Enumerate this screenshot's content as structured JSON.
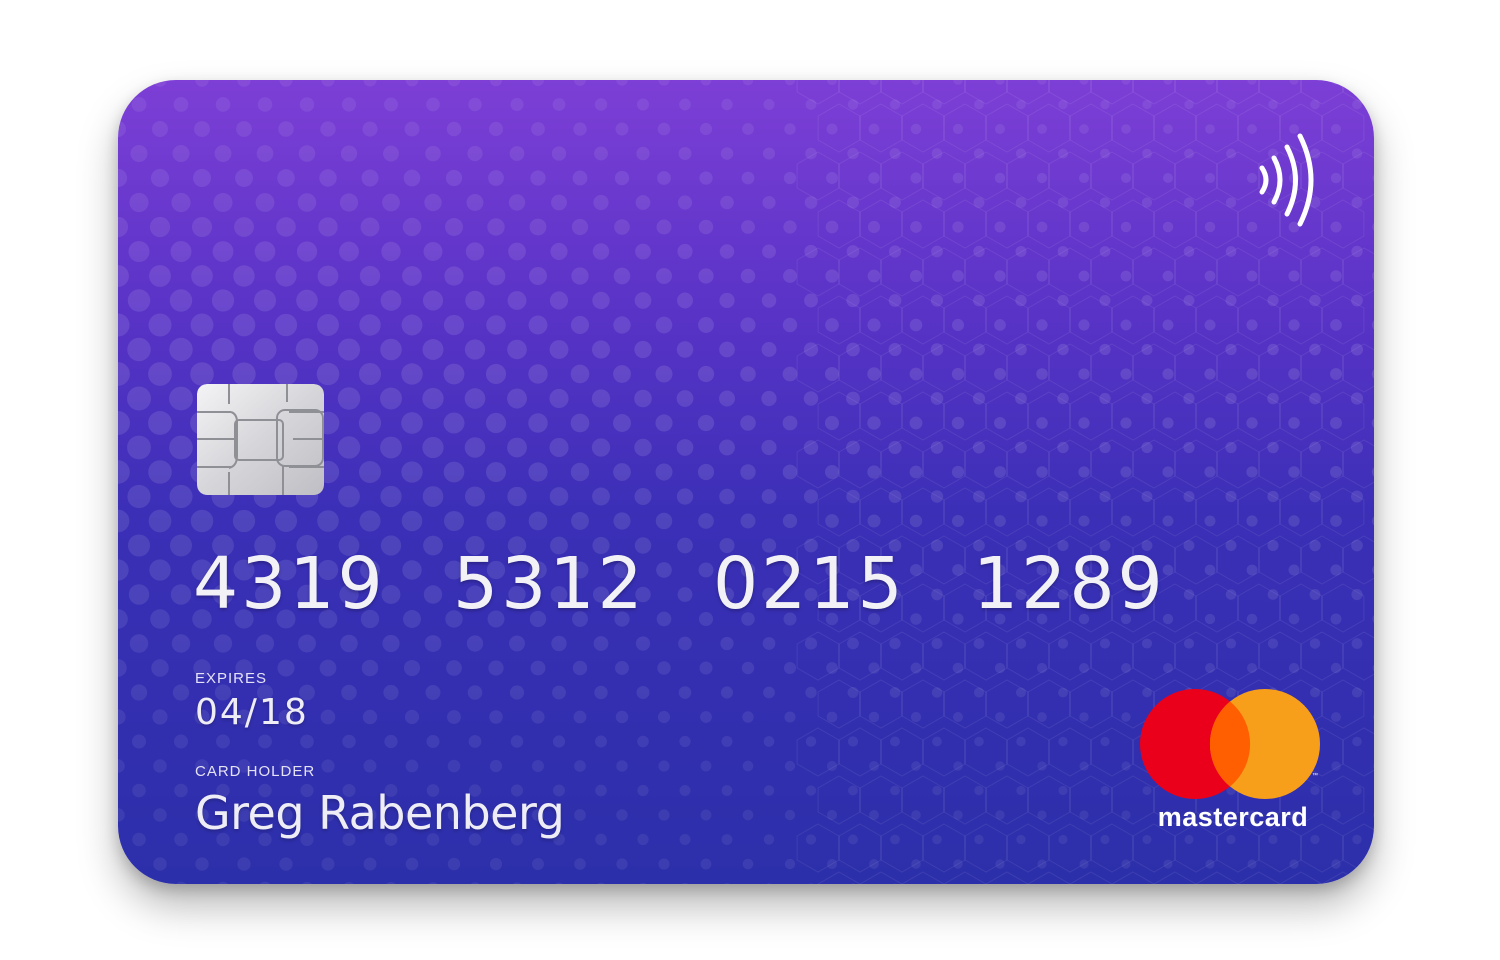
{
  "card": {
    "number_groups": [
      "4319",
      "5312",
      "0215",
      "1289"
    ],
    "expires_label": "EXPIRES",
    "expires_value": "04/18",
    "holder_label": "CARD HOLDER",
    "holder_name": "Greg Rabenberg",
    "brand": "mastercard",
    "colors": {
      "gradient_top": "#7d3fd6",
      "gradient_bottom": "#2c2faa",
      "mc_red": "#eb001b",
      "mc_orange": "#f79e1b",
      "mc_overlap": "#ff5f00"
    },
    "icons": [
      "contactless-icon",
      "chip-icon",
      "mastercard-logo"
    ]
  }
}
